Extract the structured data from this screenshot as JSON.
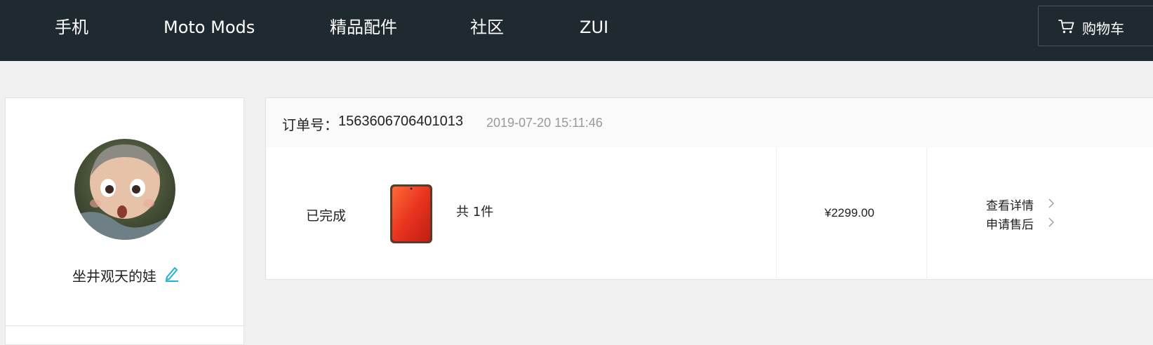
{
  "nav": {
    "items": [
      {
        "label": "手机"
      },
      {
        "label": "Moto Mods"
      },
      {
        "label": "精品配件"
      },
      {
        "label": "社区"
      },
      {
        "label": "ZUI"
      }
    ],
    "cart_label": "购物车"
  },
  "profile": {
    "username": "坐井观天的娃"
  },
  "order": {
    "number_label": "订单号：",
    "number": "1563606706401013",
    "time": "2019-07-20 15:11:46",
    "status": "已完成",
    "quantity": "共 1件",
    "price": "¥2299.00",
    "actions": [
      {
        "label": "查看详情"
      },
      {
        "label": "申请售后"
      }
    ]
  },
  "colors": {
    "nav_bg": "#1f2a30",
    "page_bg": "#f0f0f0",
    "edit_icon": "#1fb3d4"
  }
}
